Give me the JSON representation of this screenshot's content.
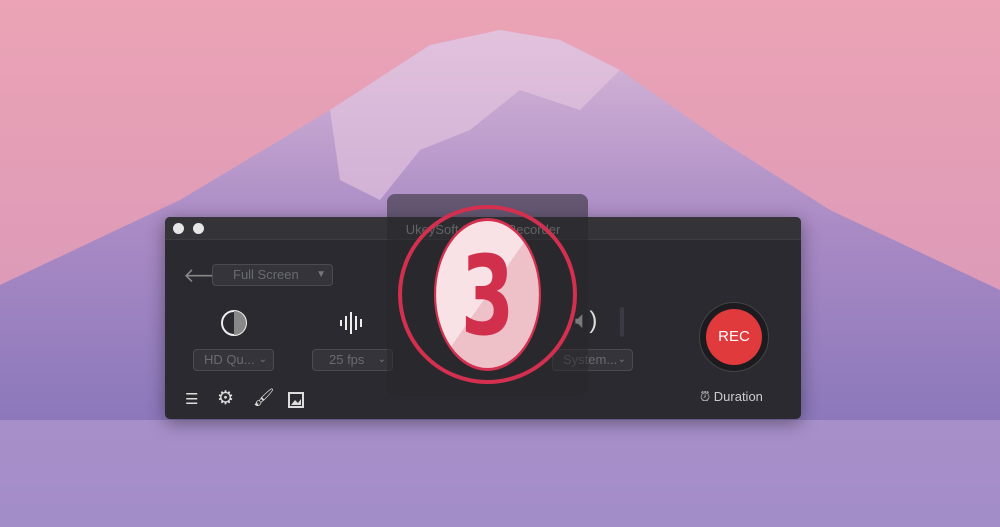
{
  "window": {
    "title": "UkeySoft Screen Recorder"
  },
  "toolbar": {
    "mode_select": "Full Screen",
    "quality_select": "HD Qu...",
    "fps_select": "25 fps",
    "audio_select": "System...",
    "rec_label": "REC",
    "duration_label": "Duration"
  },
  "countdown": {
    "value": "3"
  },
  "icons": [
    "back-arrow-icon",
    "contrast-icon",
    "waveform-icon",
    "speaker-icon",
    "list-icon",
    "gear-icon",
    "brush-icon",
    "image-icon",
    "alarm-clock-icon"
  ],
  "colors": {
    "rec": "#e03a3c",
    "countdown": "#d33050"
  }
}
